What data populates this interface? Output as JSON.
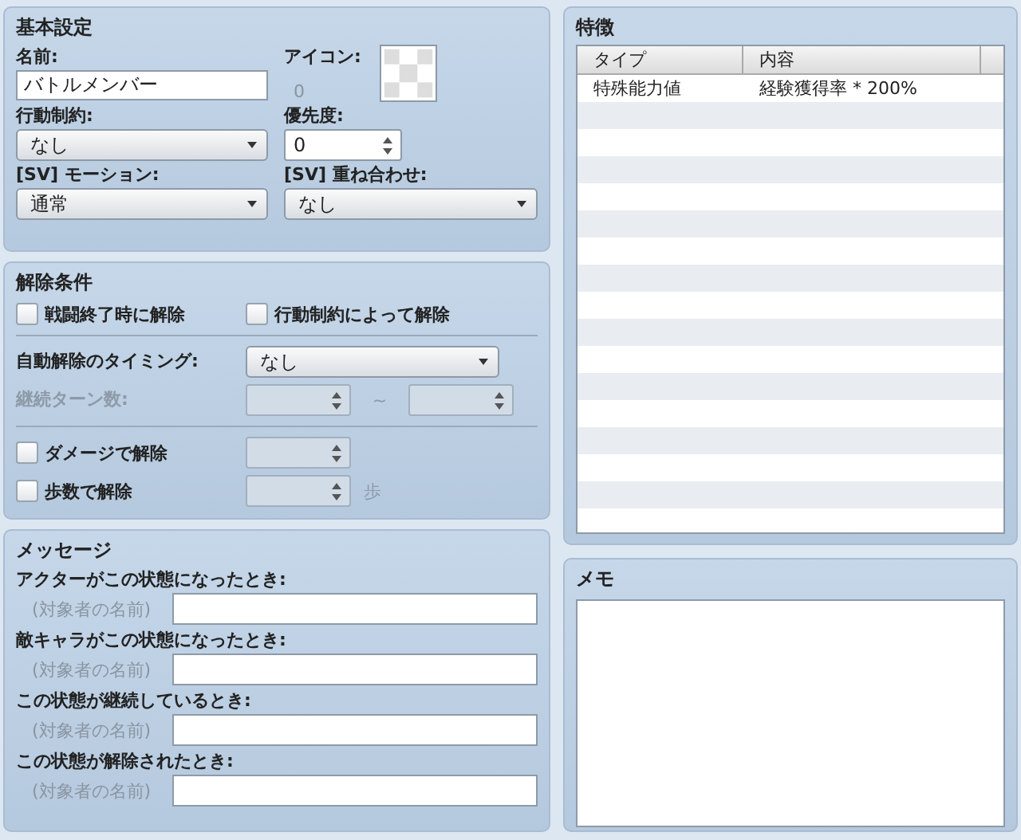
{
  "basic": {
    "title": "基本設定",
    "name": {
      "label": "名前:",
      "value": "バトルメンバー"
    },
    "icon": {
      "label": "アイコン:",
      "index": "0"
    },
    "restriction": {
      "label": "行動制約:",
      "value": "なし"
    },
    "priority": {
      "label": "優先度:",
      "value": "0"
    },
    "sv_motion": {
      "label": "[SV] モーション:",
      "value": "通常"
    },
    "sv_overlay": {
      "label": "[SV] 重ね合わせ:",
      "value": "なし"
    }
  },
  "removal": {
    "title": "解除条件",
    "battle_end": {
      "label": "戦闘終了時に解除",
      "checked": false
    },
    "by_restriction": {
      "label": "行動制約によって解除",
      "checked": false
    },
    "auto_timing": {
      "label": "自動解除のタイミング:",
      "value": "なし"
    },
    "turns": {
      "label": "継続ターン数:",
      "disabled": true,
      "separator": "~"
    },
    "damage": {
      "label": "ダメージで解除",
      "checked": false,
      "disabled": true
    },
    "steps": {
      "label": "歩数で解除",
      "checked": false,
      "disabled": true,
      "unit": "歩"
    }
  },
  "messages": {
    "title": "メッセージ",
    "items": [
      {
        "label": "アクターがこの状態になったとき:",
        "subject": "(対象者の名前)"
      },
      {
        "label": "敵キャラがこの状態になったとき:",
        "subject": "(対象者の名前)"
      },
      {
        "label": "この状態が継続しているとき:",
        "subject": "(対象者の名前)"
      },
      {
        "label": "この状態が解除されたとき:",
        "subject": "(対象者の名前)"
      }
    ]
  },
  "traits": {
    "title": "特徴",
    "columns": [
      "タイプ",
      "内容"
    ],
    "rows": [
      {
        "type": "特殊能力値",
        "content": "経験獲得率 * 200%"
      }
    ]
  },
  "note": {
    "title": "メモ"
  }
}
